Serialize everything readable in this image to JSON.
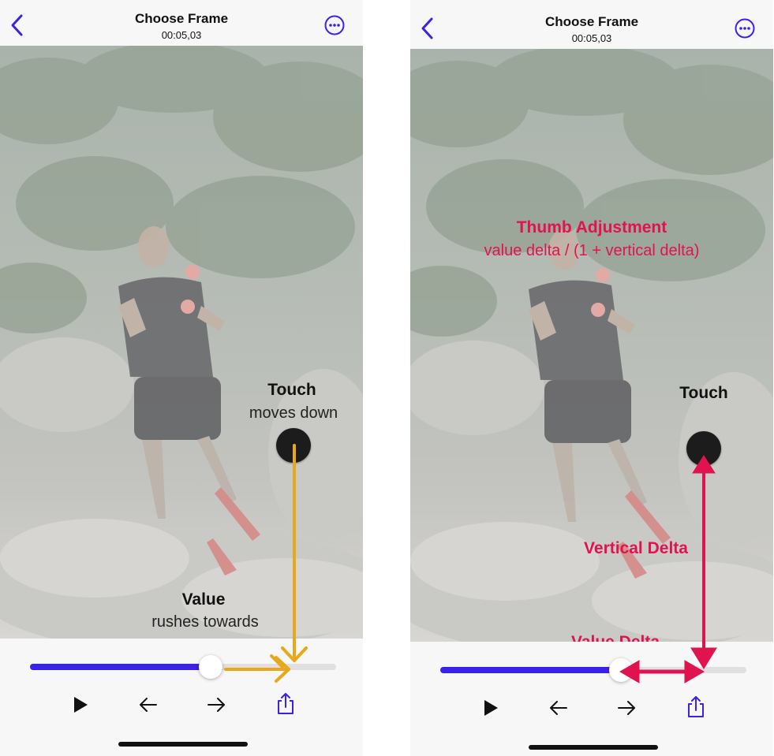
{
  "colors": {
    "accent": "#3a22e6",
    "orange_arrow": "#e8a81e",
    "red_annotation": "#e0134f"
  },
  "left_screen": {
    "nav": {
      "title": "Choose Frame",
      "time": "00:05,03",
      "back_icon": "chevron-left-icon",
      "more_icon": "ellipsis-circle-icon"
    },
    "annotations": {
      "touch_title": "Touch",
      "touch_subtitle": "moves down",
      "value_title": "Value",
      "value_subtitle": "rushes towards"
    },
    "slider": {
      "value_fraction": 0.59
    },
    "controls": [
      "play-icon",
      "arrow-left-icon",
      "arrow-right-icon",
      "share-icon"
    ]
  },
  "right_screen": {
    "nav": {
      "title": "Choose Frame",
      "time": "00:05,03",
      "back_icon": "chevron-left-icon",
      "more_icon": "ellipsis-circle-icon"
    },
    "annotations": {
      "thumb_adjustment_title": "Thumb Adjustment",
      "thumb_adjustment_formula": "value delta / (1 + vertical delta)",
      "touch_title": "Touch",
      "vertical_delta": "Vertical Delta",
      "value_delta": "Value Delta"
    },
    "slider": {
      "value_fraction": 0.59
    },
    "controls": [
      "play-icon",
      "arrow-left-icon",
      "arrow-right-icon",
      "share-icon"
    ]
  }
}
